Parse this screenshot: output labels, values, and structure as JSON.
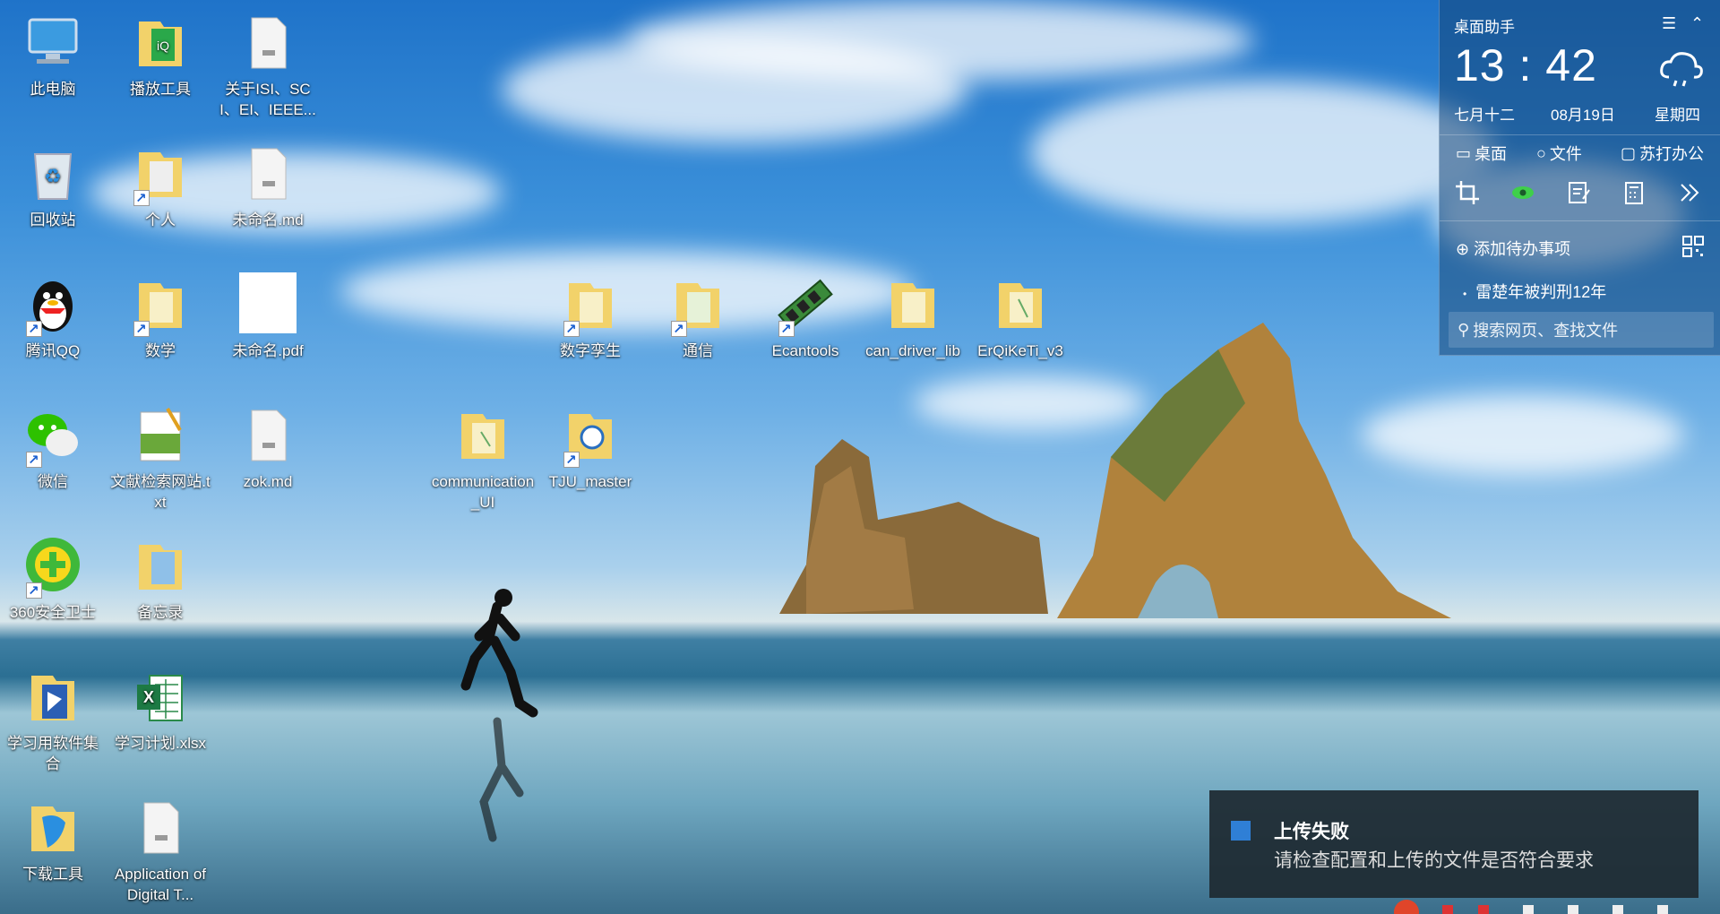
{
  "desktop_icons": [
    {
      "label": "此电脑",
      "icon": "computer-icon"
    },
    {
      "label": "播放工具",
      "icon": "folder-icon"
    },
    {
      "label": "关于ISI、SCI、EI、IEEE...",
      "icon": "file-icon"
    },
    {
      "label": "回收站",
      "icon": "recycle-bin-icon"
    },
    {
      "label": "个人",
      "icon": "folder-icon"
    },
    {
      "label": "未命名.md",
      "icon": "md-file-icon"
    },
    {
      "label": "腾讯QQ",
      "icon": "qq-icon"
    },
    {
      "label": "数学",
      "icon": "folder-icon"
    },
    {
      "label": "未命名.pdf",
      "icon": "pdf-file-icon"
    },
    {
      "label": "数字孪生",
      "icon": "folder-icon"
    },
    {
      "label": "通信",
      "icon": "folder-icon"
    },
    {
      "label": "Ecantools",
      "icon": "ecantools-icon"
    },
    {
      "label": "can_driver_lib",
      "icon": "folder-icon"
    },
    {
      "label": "ErQiKeTi_v3",
      "icon": "folder-icon"
    },
    {
      "label": "微信",
      "icon": "wechat-icon"
    },
    {
      "label": "文献检索网站.txt",
      "icon": "txt-file-icon"
    },
    {
      "label": "zok.md",
      "icon": "md-file-icon"
    },
    {
      "label": "communication_UI",
      "icon": "folder-icon"
    },
    {
      "label": "TJU_master",
      "icon": "folder-icon"
    },
    {
      "label": "360安全卫士",
      "icon": "360-icon"
    },
    {
      "label": "备忘录",
      "icon": "memo-icon"
    },
    {
      "label": "学习用软件集合",
      "icon": "folder-icon"
    },
    {
      "label": "学习计划.xlsx",
      "icon": "excel-icon"
    },
    {
      "label": "下载工具",
      "icon": "folder-icon"
    },
    {
      "label": "Application of Digital T...",
      "icon": "file-icon"
    }
  ],
  "widget": {
    "title": "桌面助手",
    "time": "13 : 42",
    "lunar_date": "七月十二",
    "date": "08月19日",
    "weekday": "星期四",
    "weather_icon": "cloud-rain-icon",
    "nav": [
      "桌面",
      "文件",
      "苏打办公"
    ],
    "add_todo": "添加待办事项",
    "news_item": "雷楚年被判刑12年",
    "search_placeholder": "搜索网页、查找文件"
  },
  "toast": {
    "title": "上传失败",
    "message": "请检查配置和上传的文件是否符合要求"
  }
}
